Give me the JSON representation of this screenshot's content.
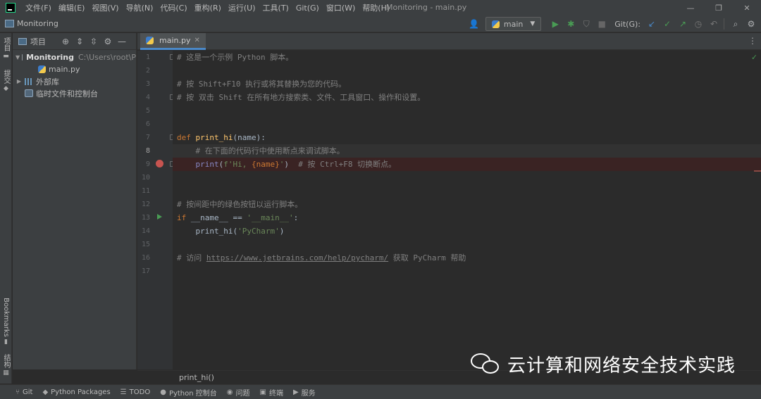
{
  "menubar": {
    "items": [
      "文件(F)",
      "编辑(E)",
      "视图(V)",
      "导航(N)",
      "代码(C)",
      "重构(R)",
      "运行(U)",
      "工具(T)",
      "Git(G)",
      "窗口(W)",
      "帮助(H)"
    ],
    "window_title": "Monitoring - main.py"
  },
  "navbar": {
    "project_crumb": "Monitoring",
    "run_config": "main",
    "git_label": "Git(G):"
  },
  "left_stripe": {
    "project": "项目",
    "commit": "提交",
    "bookmarks": "Bookmarks",
    "structure": "结构"
  },
  "project_panel": {
    "title": "项目",
    "root_name": "Monitoring",
    "root_path": "C:\\Users\\root\\P",
    "file_main": "main.py",
    "external_libs": "外部库",
    "scratches": "临时文件和控制台"
  },
  "editor_tab": {
    "label": "main.py"
  },
  "editor": {
    "line_numbers": [
      "1",
      "2",
      "3",
      "4",
      "5",
      "6",
      "7",
      "8",
      "9",
      "10",
      "11",
      "12",
      "13",
      "14",
      "15",
      "16",
      "17"
    ],
    "lines": {
      "l1": "# 这是一个示例 Python 脚本。",
      "l3": "# 按 Shift+F10 执行或将其替换为您的代码。",
      "l4": "# 按 双击 Shift 在所有地方搜索类、文件、工具窗口、操作和设置。",
      "l7_def": "def ",
      "l7_fn": "print_hi",
      "l7_rest": "(name):",
      "l8": "    # 在下面的代码行中使用断点来调试脚本。",
      "l9_indent": "    ",
      "l9_print": "print",
      "l9_open": "(",
      "l9_str1": "f'Hi, ",
      "l9_expr": "{name}",
      "l9_str2": "'",
      "l9_close": ")  ",
      "l9_comment": "# 按 Ctrl+F8 切换断点。",
      "l12": "# 按间距中的绿色按钮以运行脚本。",
      "l13_if": "if ",
      "l13_name": "__name__ == ",
      "l13_str": "'__main__'",
      "l13_colon": ":",
      "l14_indent": "    print_hi(",
      "l14_str": "'PyCharm'",
      "l14_close": ")",
      "l16_a": "# 访问 ",
      "l16_link": "https://www.jetbrains.com/help/pycharm/",
      "l16_b": " 获取 PyCharm 帮助"
    }
  },
  "breadcrumb": "print_hi()",
  "bottom_bar": {
    "items": [
      {
        "icon": "⑂",
        "label": "Git"
      },
      {
        "icon": "◆",
        "label": "Python Packages"
      },
      {
        "icon": "☰",
        "label": "TODO"
      },
      {
        "icon": "●",
        "label": "Python 控制台"
      },
      {
        "icon": "◉",
        "label": "问题"
      },
      {
        "icon": "▣",
        "label": "终端"
      },
      {
        "icon": "▶",
        "label": "服务"
      }
    ]
  },
  "watermark": {
    "text": "云计算和网络安全技术实践"
  },
  "colors": {
    "background": "#2b2b2b",
    "panel": "#3c3f41",
    "keyword": "#cc7832",
    "function": "#ffc66d",
    "string": "#6a8759",
    "comment": "#808080",
    "breakpoint": "#c75450",
    "run_green": "#499c54"
  },
  "icons": [
    "app-logo",
    "user-icon",
    "python-icon",
    "run-icon",
    "debug-icon",
    "coverage-icon",
    "stop-icon",
    "git-update-icon",
    "git-commit-icon",
    "git-push-icon",
    "history-icon",
    "rollback-icon",
    "search-icon",
    "settings-icon",
    "folder-icon",
    "globe-icon",
    "expand-icon",
    "collapse-icon",
    "gear-icon",
    "minus-icon",
    "close-icon",
    "breakpoint-icon",
    "run-gutter-icon",
    "check-icon",
    "wechat-logo"
  ]
}
